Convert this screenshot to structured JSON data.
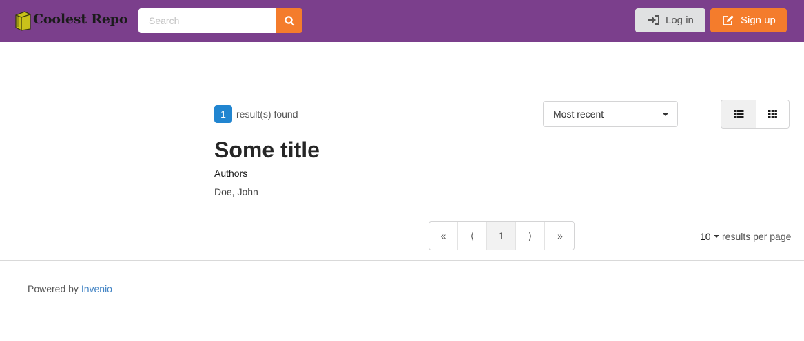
{
  "header": {
    "brand": "Coolest Repo",
    "search": {
      "placeholder": "Search",
      "value": ""
    },
    "login_label": "Log in",
    "signup_label": "Sign up",
    "colors": {
      "bar": "#7b3f8c",
      "accent": "#f47c2c",
      "login_bg": "#e0e1e2"
    }
  },
  "results": {
    "count": "1",
    "found_text": "result(s) found",
    "sort_selected": "Most recent",
    "view_modes": [
      "list-icon",
      "grid-icon"
    ]
  },
  "items": [
    {
      "title": "Some title",
      "authors_heading": "Authors",
      "authors": "Doe, John"
    }
  ],
  "pagination": {
    "first": "«",
    "prev": "⟨",
    "current": "1",
    "next": "⟩",
    "last": "»",
    "per_page_value": "10",
    "per_page_text": "results per page"
  },
  "footer": {
    "powered_by": "Powered by",
    "link_text": "Invenio",
    "link_color": "#4183c4"
  }
}
